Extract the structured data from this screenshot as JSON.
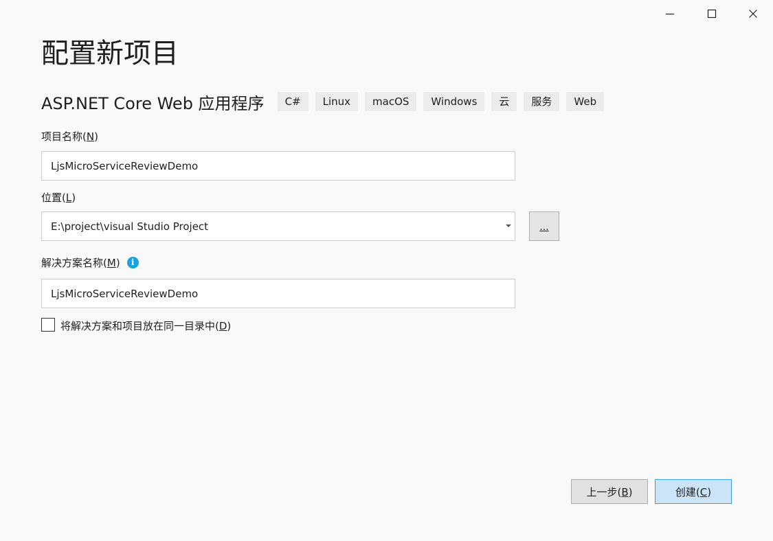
{
  "window_controls": {
    "minimize_icon": "minimize-icon",
    "maximize_icon": "maximize-icon",
    "close_icon": "close-icon"
  },
  "page_title": "配置新项目",
  "template": {
    "name": "ASP.NET Core Web 应用程序",
    "tags": [
      "C#",
      "Linux",
      "macOS",
      "Windows",
      "云",
      "服务",
      "Web"
    ]
  },
  "project_name": {
    "label_text": "项目名称(",
    "label_key": "N",
    "label_end": ")",
    "value": "LjsMicroServiceReviewDemo"
  },
  "location": {
    "label_text": "位置(",
    "label_key": "L",
    "label_end": ")",
    "value": "E:\\project\\visual Studio Project",
    "browse_label": "..."
  },
  "solution_name": {
    "label_text": "解决方案名称(",
    "label_key": "M",
    "label_end": ")",
    "info_icon": "i",
    "value": "LjsMicroServiceReviewDemo"
  },
  "same_directory": {
    "label_text": "将解决方案和项目放在同一目录中(",
    "label_key": "D",
    "label_end": ")",
    "checked": false
  },
  "footer": {
    "back_text": "上一步(",
    "back_key": "B",
    "back_end": ")",
    "create_text": "创建(",
    "create_key": "C",
    "create_end": ")"
  },
  "colors": {
    "background": "#f9f9f9",
    "tag_background": "#ececec",
    "info_blue": "#1ba1e2",
    "primary_border": "#3c9de0",
    "primary_fill": "#cce4f7"
  }
}
